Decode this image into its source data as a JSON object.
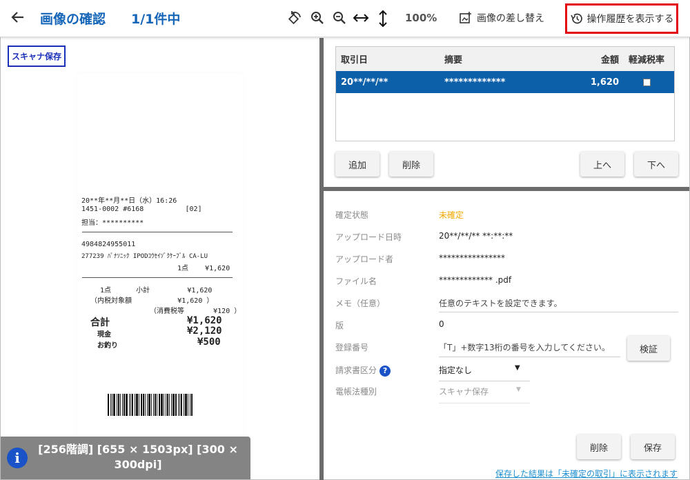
{
  "header": {
    "title": "画像の確認",
    "count": "1/1件中",
    "zoom": "100%",
    "replace_label": "画像の差し替え",
    "history_label": "操作履歴を表示する"
  },
  "left": {
    "scan_badge": "スキャナ保存",
    "info_lines": [
      "[256階調] [655 × 1503px] [300 ×",
      "300dpi]"
    ],
    "receipt": {
      "line1": "20**年**月**日（水）16:26",
      "line2": "1451-0002 #6168          [02]",
      "line3": "担当：**********",
      "line4": "4984824955011",
      "line5": "277239 ﾊﾟﾅｿﾆｯｸ IPODｺｳｾｲｿﾞｸｹｰﾌﾞﾙ CA-LU",
      "line6": "1点    ¥1,620",
      "line7": "1点      小計         ¥1,620",
      "line8": "（内税対象額           ¥1,620 ）",
      "line9": "（消費税等       ¥120 ）",
      "total_label": "合計",
      "total_value": "¥1,620",
      "cash_label": "現金",
      "cash_value": "¥2,120",
      "change_label": "お釣り",
      "change_value": "¥500"
    }
  },
  "table": {
    "headers": [
      "取引日",
      "摘要",
      "金額",
      "軽減税率"
    ],
    "rows": [
      {
        "date": "20**/**/**",
        "summary": "*************",
        "amount": "1,620",
        "reduced": false
      }
    ]
  },
  "table_buttons": {
    "add": "追加",
    "delete": "削除",
    "up": "上へ",
    "down": "下へ"
  },
  "details": {
    "status_label": "確定状態",
    "status_value": "未確定",
    "status_color": "#f0a800",
    "upload_date_label": "アップロード日時",
    "upload_date_value": "20**/**/** **:**:**",
    "uploader_label": "アップロード者",
    "uploader_value": "****************",
    "filename_label": "ファイル名",
    "filename_value": "************* .pdf",
    "memo_label": "メモ（任意）",
    "memo_placeholder": "任意のテキストを設定できます。",
    "version_label": "版",
    "version_value": "0",
    "reg_label": "登録番号",
    "reg_placeholder": "「T」+数字13桁の番号を入力してください。",
    "verify_label": "検証",
    "invoice_label": "請求書区分",
    "invoice_value": "指定なし",
    "ledger_label": "電帳法種別",
    "ledger_value": "スキャナ保存",
    "delete_label": "削除",
    "save_label": "保存",
    "footer_link": "保存した結果は「未確定の取引」に表示されます"
  }
}
